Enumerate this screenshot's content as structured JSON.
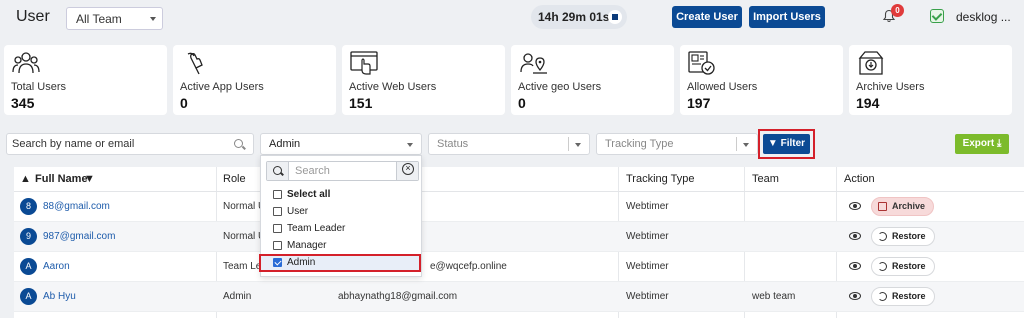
{
  "header": {
    "title": "User",
    "team_select": "All Team",
    "timer": "14h 29m 01s",
    "create_user": "Create User",
    "import_users": "Import Users",
    "notification_count": "0",
    "user_name": "desklog ..."
  },
  "stats": [
    {
      "label": "Total Users",
      "value": "345",
      "icon": "users-group-icon"
    },
    {
      "label": "Active App Users",
      "value": "0",
      "icon": "touch-hand-icon"
    },
    {
      "label": "Active Web Users",
      "value": "151",
      "icon": "browser-click-icon"
    },
    {
      "label": "Active geo Users",
      "value": "0",
      "icon": "user-location-icon"
    },
    {
      "label": "Allowed Users",
      "value": "197",
      "icon": "id-card-check-icon"
    },
    {
      "label": "Archive Users",
      "value": "194",
      "icon": "archive-box-icon"
    }
  ],
  "filters": {
    "search_placeholder": "Search by name or email",
    "role_value": "Admin",
    "status_placeholder": "Status",
    "tracking_placeholder": "Tracking Type",
    "filter_label": "Filter",
    "export_label": "Export"
  },
  "dropdown": {
    "search_placeholder": "Search",
    "options": [
      {
        "label": "Select all",
        "checked": false,
        "bold": true
      },
      {
        "label": "User",
        "checked": false
      },
      {
        "label": "Team Leader",
        "checked": false
      },
      {
        "label": "Manager",
        "checked": false
      },
      {
        "label": "Admin",
        "checked": true
      }
    ]
  },
  "table": {
    "columns": [
      "Full Name",
      "Role",
      "Tracking Type",
      "Team",
      "Action"
    ],
    "rows": [
      {
        "initial": "8",
        "name": "88@gmail.com",
        "role": "Normal U",
        "email": "",
        "tracking": "Webtimer",
        "team": "",
        "action": "Archive"
      },
      {
        "initial": "9",
        "name": "987@gmail.com",
        "role": "Normal U",
        "email": "",
        "tracking": "Webtimer",
        "team": "",
        "action": "Restore"
      },
      {
        "initial": "A",
        "name": "Aaron",
        "role": "Team Lea",
        "email": "e@wqcefp.online",
        "tracking": "Webtimer",
        "team": "",
        "action": "Restore"
      },
      {
        "initial": "A",
        "name": "Ab Hyu",
        "role": "Admin",
        "email": "abhaynathg18@gmail.com",
        "tracking": "Webtimer",
        "team": "web team",
        "action": "Restore"
      }
    ]
  }
}
